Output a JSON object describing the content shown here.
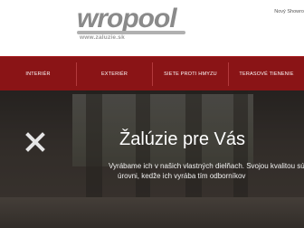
{
  "header": {
    "logo_text": "wropool",
    "logo_url": "www.zaluzie.sk",
    "corner_link": "Nový Showro"
  },
  "nav": {
    "items": [
      {
        "label": "INTERIÉR"
      },
      {
        "label": "EXTERIÉR"
      },
      {
        "label": "SIETE PROTI HMYZU"
      },
      {
        "label": "TERASOVÉ TIENENIE"
      }
    ],
    "background": "#8a1416"
  },
  "hero": {
    "title": "Žalúzie pre Vás",
    "line1": "Vyrábame ich v našich vlastných dielňach. Svojou kvalitou sú na vyso",
    "line2": "úrovni, kedže ich vyrába tím odborníkov"
  },
  "icons": {
    "close": "close-x-icon"
  }
}
